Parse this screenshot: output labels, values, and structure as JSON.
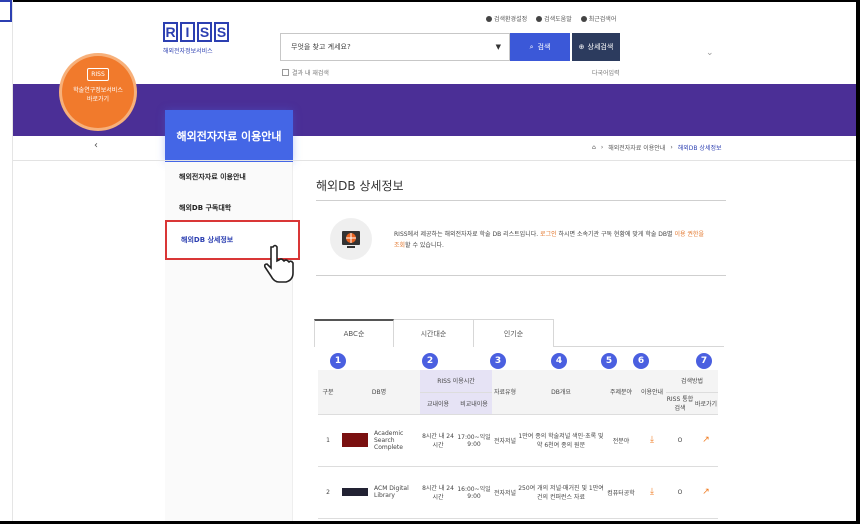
{
  "header": {
    "logo_letters": [
      "R",
      "I",
      "S",
      "S"
    ],
    "logo_sub": "해외전자정보서비스",
    "util_links": [
      "검색환경설정",
      "검색도움말",
      "최근검색어"
    ],
    "search_placeholder": "무엇을 찾고 계세요?",
    "search_button": "검색",
    "detail_button": "상세검색",
    "checkbox_label": "결과 내 재검색",
    "multilang_label": "다국어입력"
  },
  "promo": {
    "label_line1": "학술연구정보서비스",
    "label_line2": "바로가기",
    "icon_text": "RISS"
  },
  "sidebar": {
    "title": "해외전자자료 이용안내",
    "items": [
      {
        "label": "해외전자자료 이용안내"
      },
      {
        "label": "해외DB 구독대학"
      },
      {
        "label": "해외DB 상세정보"
      }
    ]
  },
  "breadcrumb": [
    "해외전자자료 이용안내",
    "해외DB 상세정보"
  ],
  "main": {
    "title": "해외DB 상세정보",
    "info_part1": "RISS에서 제공하는 해외전자자료 학술 DB 리스트입니다. ",
    "info_login": "로그인",
    "info_part2": " 하시면 소속기관 구독 현황에 맞게 학술 DB별 ",
    "info_highlight": "이용 권한을 조회",
    "info_part3": "할 수 있습니다."
  },
  "tabs": [
    "ABC순",
    "시간대순",
    "인기순"
  ],
  "markers": [
    "1",
    "2",
    "3",
    "4",
    "5",
    "6",
    "7"
  ],
  "table": {
    "headers": {
      "col_gubun": "구분",
      "col_dbname": "DB명",
      "col_time_group": "RISS 이용시간",
      "col_time_cam": "교내이용",
      "col_time_off": "비교내이용",
      "col_type": "자료유형",
      "col_desc": "DB개요",
      "col_subject": "주제분야",
      "col_use": "이용안내",
      "col_search_group": "검색방법",
      "col_riss": "RISS 통합검색",
      "col_go": "바로가기"
    },
    "rows": [
      {
        "no": "1",
        "db": "Academic Search Complete",
        "time_cam": "8시간 내 24시간",
        "time_off": "17:00~익일9:00",
        "type": "전자저널",
        "desc": "1만여 종의 학술저널 색인·초록 및 약 6천여 종의 원문",
        "subject": "전분야",
        "riss": "O"
      },
      {
        "no": "2",
        "db": "ACM Digital Library",
        "time_cam": "8시간 내 24시간",
        "time_off": "16:00~익일9:00",
        "type": "전자저널",
        "desc": "250여 개의 저널·매거진 및 1만여 건의 컨퍼런스 자료",
        "subject": "컴퓨터공학",
        "riss": "O"
      }
    ]
  },
  "colors": {
    "purple": "#4b2f96",
    "accent": "#4466e6",
    "orange": "#f17a2c",
    "highlight_border": "#d93636"
  }
}
